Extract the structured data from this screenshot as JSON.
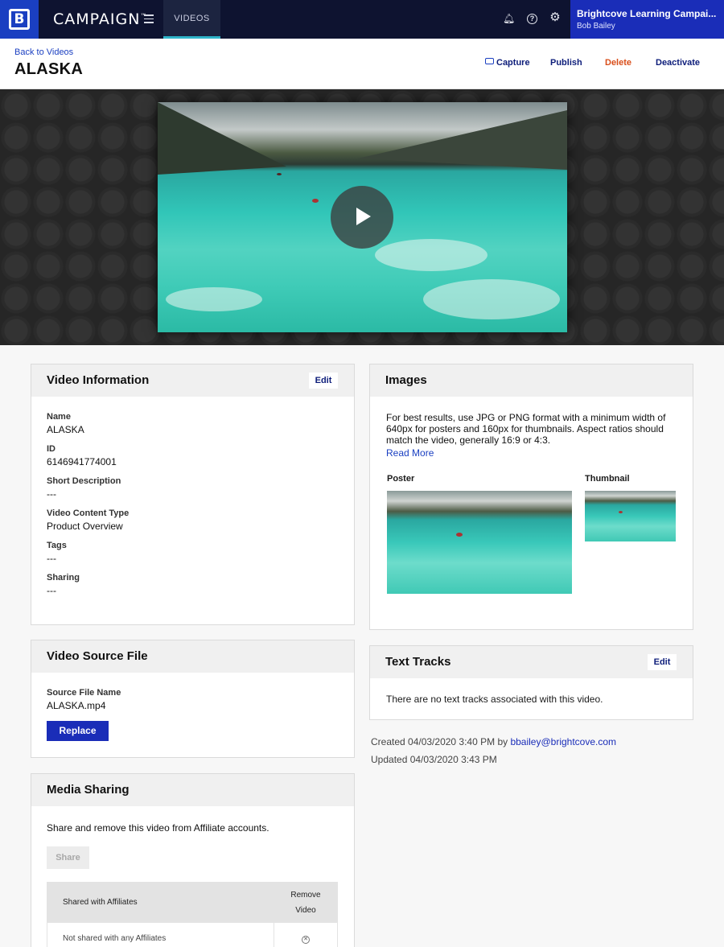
{
  "nav": {
    "brand": "CAMPAIGN",
    "brand_mark": "™",
    "active_tab": "VIDEOS",
    "account_name": "Brightcove Learning Campai...",
    "account_user": "Bob Bailey",
    "icons": [
      "bell-icon",
      "help-icon",
      "gear-icon",
      "menu-icon"
    ]
  },
  "header": {
    "back_link": "Back to Videos",
    "title": "ALASKA",
    "actions": {
      "capture": "Capture",
      "publish": "Publish",
      "delete": "Delete",
      "deactivate": "Deactivate"
    }
  },
  "video_information": {
    "heading": "Video Information",
    "edit_label": "Edit",
    "fields": [
      {
        "label": "Name",
        "value": "ALASKA"
      },
      {
        "label": "ID",
        "value": "6146941774001"
      },
      {
        "label": "Short Description",
        "value": "---"
      },
      {
        "label": "Video Content Type",
        "value": "Product Overview"
      },
      {
        "label": "Tags",
        "value": "---"
      },
      {
        "label": "Sharing",
        "value": "---"
      }
    ]
  },
  "images": {
    "heading": "Images",
    "description": "For best results, use JPG or PNG format with a minimum width of 640px for posters and 160px for thumbnails. Aspect ratios should match the video, generally 16:9 or 4:3.",
    "read_more": "Read More",
    "poster_label": "Poster",
    "thumbnail_label": "Thumbnail"
  },
  "source_file": {
    "heading": "Video Source File",
    "label": "Source File Name",
    "value": "ALASKA.mp4",
    "replace_label": "Replace"
  },
  "text_tracks": {
    "heading": "Text Tracks",
    "edit_label": "Edit",
    "empty_message": "There are no text tracks associated with this video."
  },
  "meta": {
    "created_prefix": "Created 04/03/2020 3:40 PM by ",
    "created_by": "bbailey@brightcove.com",
    "updated": "Updated 04/03/2020 3:43 PM"
  },
  "media_sharing": {
    "heading": "Media Sharing",
    "description": "Share and remove this video from Affiliate accounts.",
    "share_label": "Share",
    "table_headers": {
      "affiliates": "Shared with Affiliates",
      "remove_line1": "Remove",
      "remove_line2": "Video"
    },
    "row_text": "Not shared with any Affiliates"
  },
  "colors": {
    "nav_bg": "#0e1330",
    "brand_blue": "#1a3fc1",
    "account_bg": "#1a2db8",
    "delete_orange": "#d94e1a",
    "active_tab_underline": "#2fb4c9"
  }
}
